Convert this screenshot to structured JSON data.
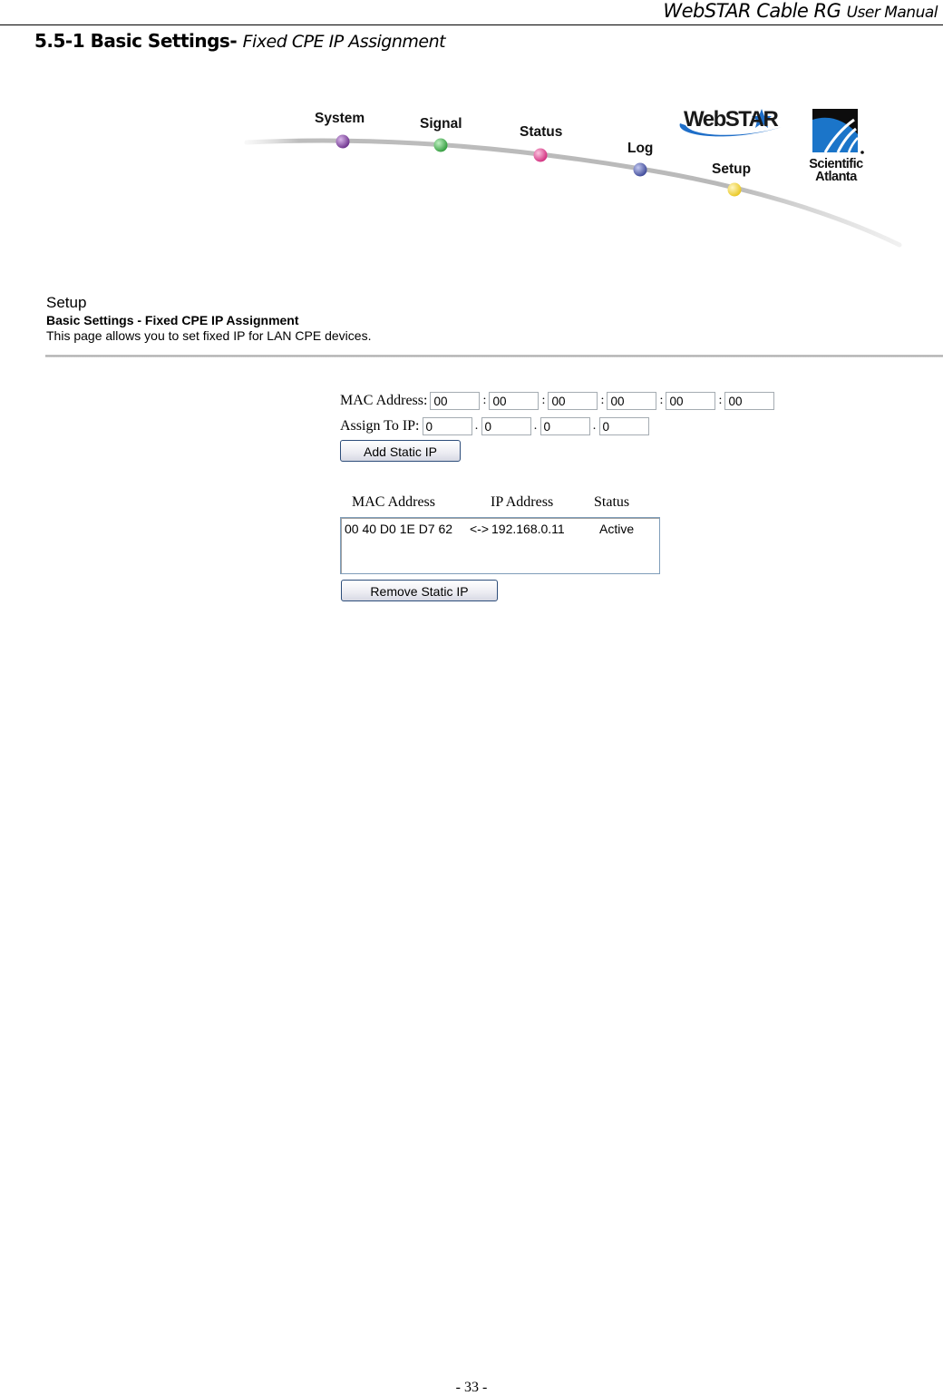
{
  "doc": {
    "header_title": "WebSTAR Cable RG",
    "header_suffix": "User Manual",
    "section_number_title": "5.5-1 Basic Settings-",
    "section_subtitle": "Fixed CPE IP Assignment",
    "page_number": "- 33 -"
  },
  "nav": {
    "items": [
      {
        "label": "System",
        "color": "#7b3f9b"
      },
      {
        "label": "Signal",
        "color": "#3fae4a"
      },
      {
        "label": "Status",
        "color": "#e0498e"
      },
      {
        "label": "Log",
        "color": "#4a56a6"
      },
      {
        "label": "Setup",
        "color": "#f2d53a"
      }
    ],
    "brand_logo": "WebSTAR",
    "company_logo_line1": "Scientific",
    "company_logo_line2": "Atlanta"
  },
  "setup": {
    "title": "Setup",
    "subtitle": "Basic Settings - Fixed CPE IP Assignment",
    "description": "This page allows you to set fixed IP for LAN CPE devices."
  },
  "form": {
    "mac_label": "MAC Address:",
    "mac_fields": [
      "00",
      "00",
      "00",
      "00",
      "00",
      "00"
    ],
    "mac_separator": ":",
    "ip_label": "Assign To IP:",
    "ip_fields": [
      "0",
      "0",
      "0",
      "0"
    ],
    "ip_separator": ".",
    "add_button": "Add Static IP"
  },
  "table": {
    "headers": [
      "MAC Address",
      "IP Address",
      "Status"
    ],
    "rows": [
      {
        "mac": "00 40 D0 1E D7 62",
        "arrow": "<->",
        "ip": "192.168.0.11",
        "status": "Active"
      }
    ],
    "remove_button": "Remove Static IP"
  }
}
